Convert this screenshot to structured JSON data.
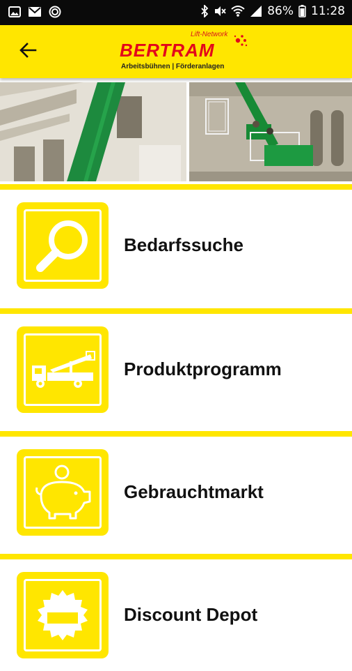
{
  "status_bar": {
    "battery_percent": "86%",
    "time": "11:28",
    "icons": [
      "image-icon",
      "mail-icon",
      "record-icon",
      "bluetooth-icon",
      "mute-icon",
      "wifi-icon",
      "signal-icon",
      "battery-icon"
    ]
  },
  "app_bar": {
    "back_icon": "arrow-left-icon",
    "logo": {
      "network": "Lift-Network",
      "brand": "BERTRAM",
      "tagline": "Arbeitsbühnen | Förderanlagen"
    },
    "colors": {
      "bar": "#ffe600",
      "brand": "#e3061b"
    }
  },
  "menu": {
    "items": [
      {
        "label": "Bedarfssuche",
        "icon": "magnifier-icon"
      },
      {
        "label": "Produktprogramm",
        "icon": "truck-lift-icon"
      },
      {
        "label": "Gebrauchtmarkt",
        "icon": "piggy-bank-icon"
      },
      {
        "label": "Discount Depot",
        "icon": "sale-tag-icon"
      }
    ]
  }
}
